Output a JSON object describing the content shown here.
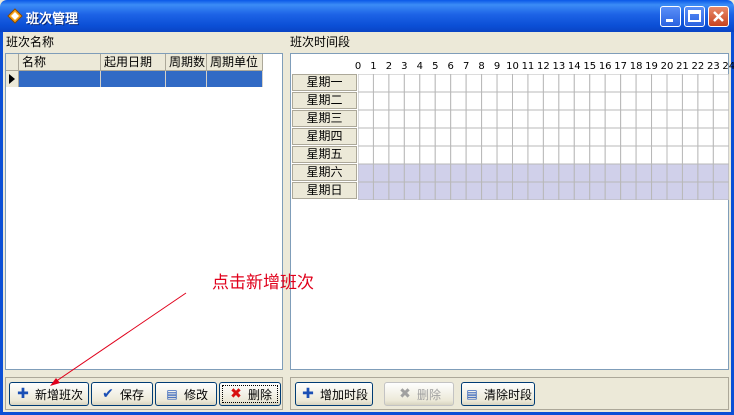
{
  "window": {
    "title": "班次管理"
  },
  "left": {
    "label": "班次名称",
    "columns": [
      "名称",
      "起用日期",
      "周期数",
      "周期单位"
    ]
  },
  "right": {
    "label": "班次时间段",
    "hours": [
      "0",
      "1",
      "2",
      "3",
      "4",
      "5",
      "6",
      "7",
      "8",
      "9",
      "10",
      "11",
      "12",
      "13",
      "14",
      "15",
      "16",
      "17",
      "18",
      "19",
      "20",
      "21",
      "22",
      "23",
      "24"
    ],
    "days": [
      "星期一",
      "星期二",
      "星期三",
      "星期四",
      "星期五",
      "星期六",
      "星期日"
    ],
    "highlight_days": [
      "星期六",
      "星期日"
    ],
    "highlight_color": "#d0d0ea"
  },
  "buttons": {
    "add_shift": "新增班次",
    "save": "保存",
    "edit": "修改",
    "delete": "删除",
    "add_period": "增加时段",
    "delete_period": "删除",
    "clear_period": "清除时段"
  },
  "annotation": "点击新增班次",
  "colors": {
    "selection": "#316ac5",
    "annotation": "#e0001b",
    "titlebar": "#0b4fd6"
  }
}
